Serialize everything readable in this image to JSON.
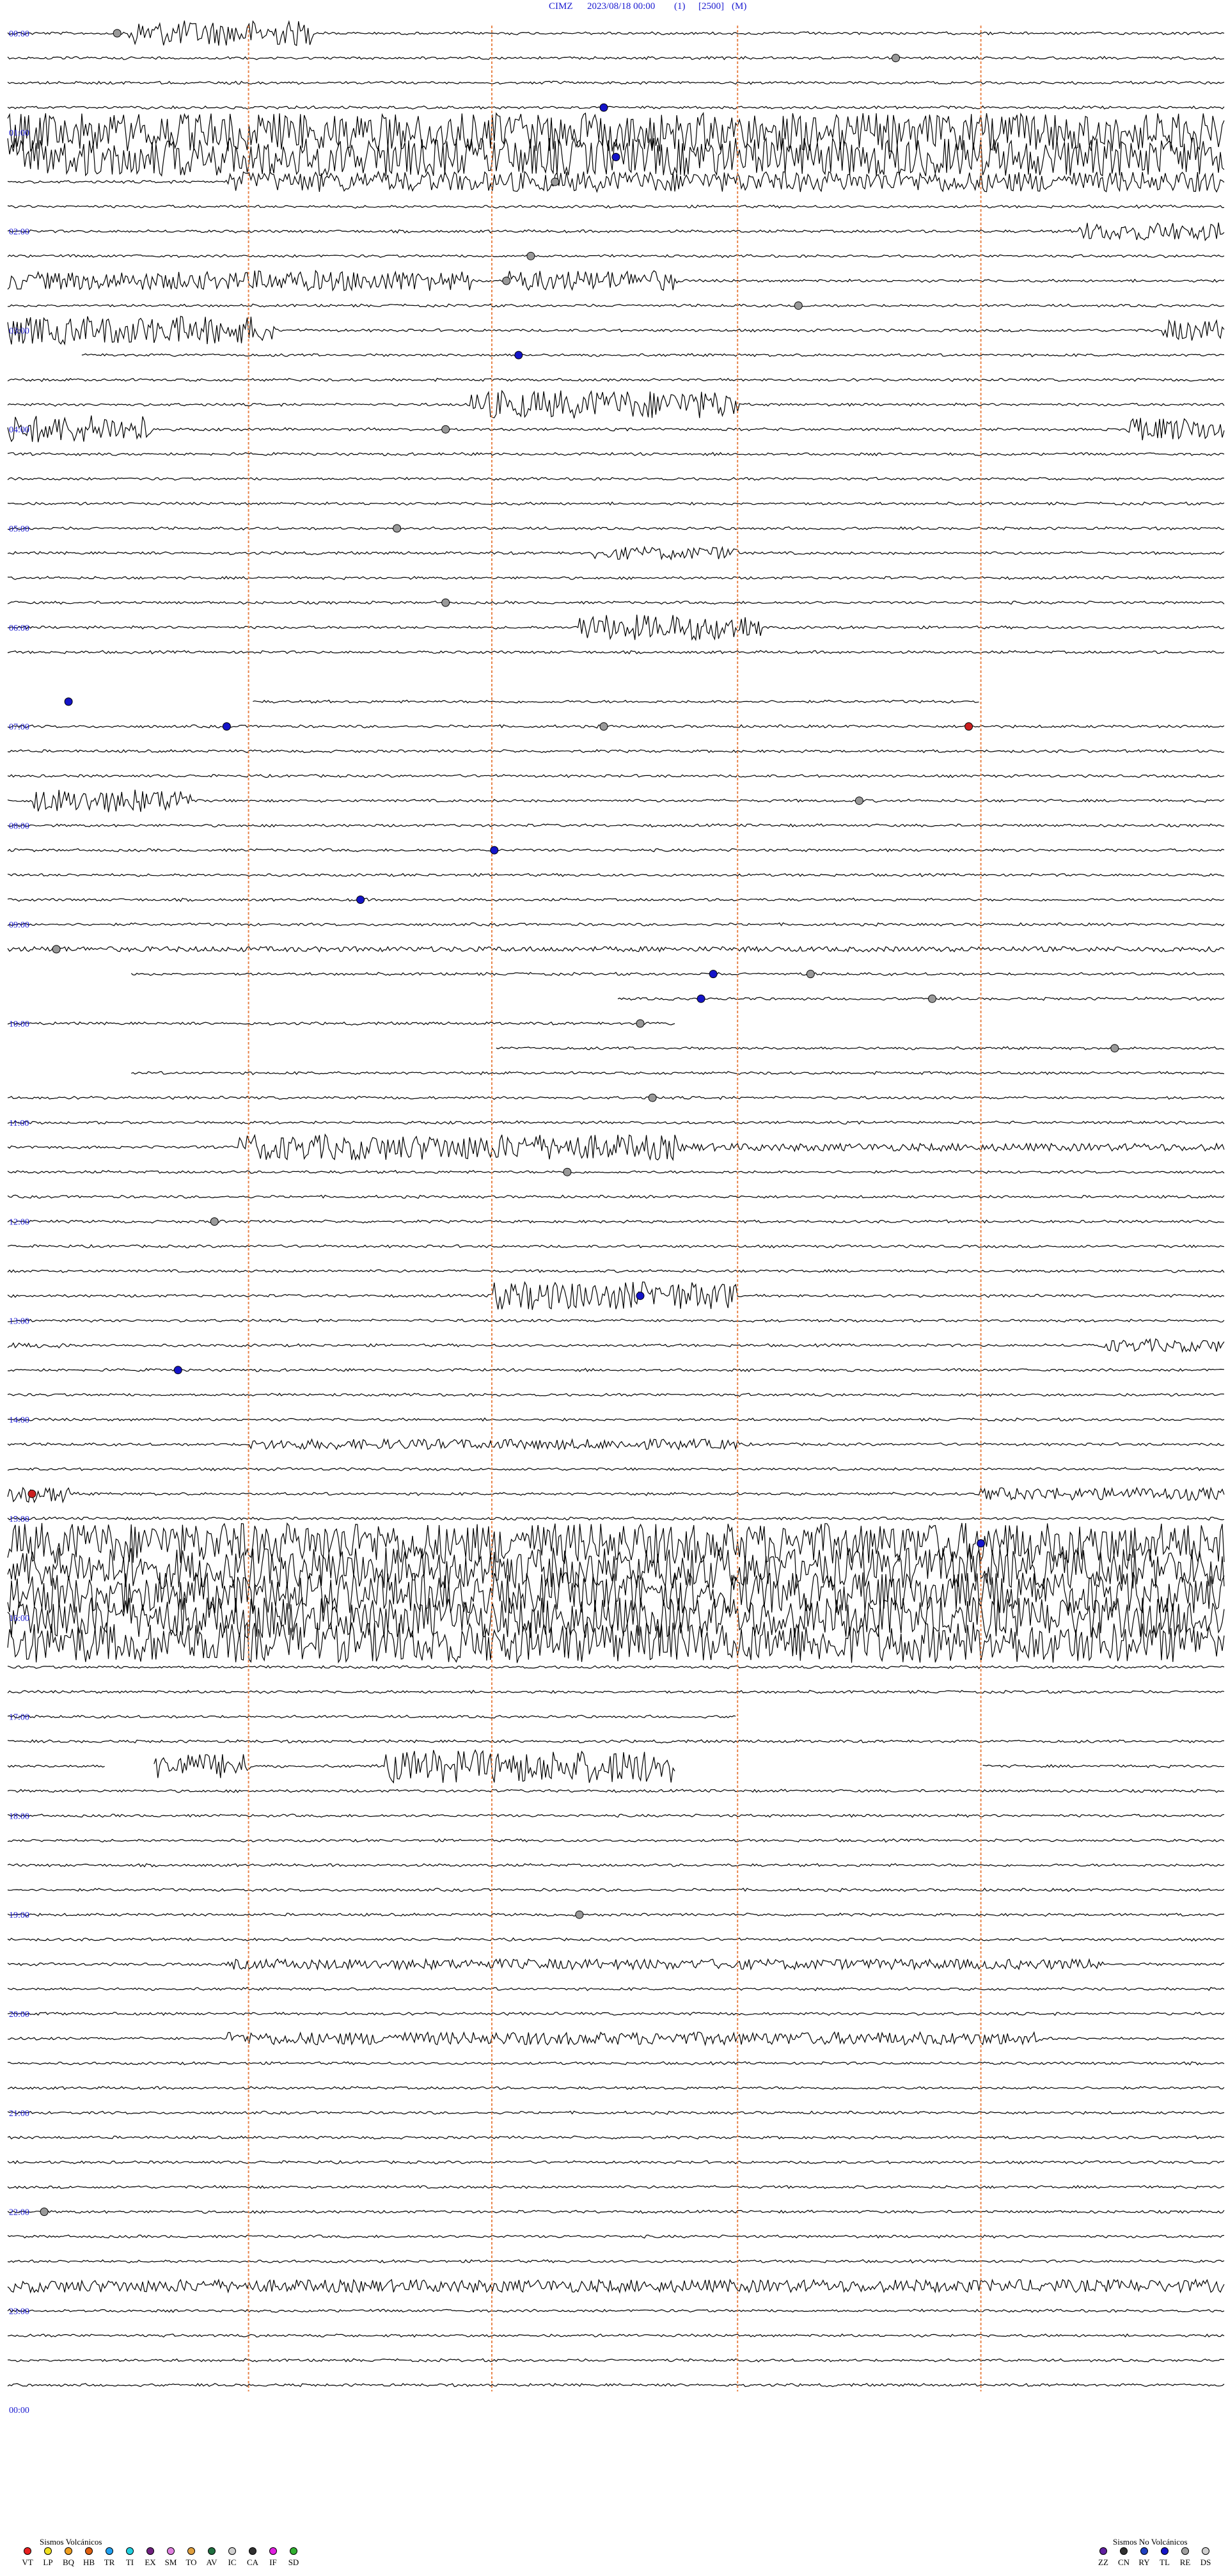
{
  "header": {
    "station": "CIMZ",
    "datetime": "2023/08/18 00:00",
    "channel": "(1)",
    "scale": "[2500]",
    "mode": "(M)"
  },
  "chart_data": {
    "type": "helicorder",
    "line_count": 96,
    "hour_labels": [
      "00:00",
      "01:00",
      "02:00",
      "03:00",
      "04:00",
      "05:00",
      "06:00",
      "07:00",
      "08:00",
      "09:00",
      "10:00",
      "11:00",
      "12:00",
      "13:00",
      "14:00",
      "15:00",
      "16:00",
      "17:00",
      "18:00",
      "19:00",
      "20:00",
      "21:00",
      "22:00",
      "23:00",
      "00:00"
    ],
    "colors": {
      "trace": "#000000",
      "hour_label": "#1a1ad0",
      "minute_marker": "#e8844a",
      "event_grey": "#9a9a9a",
      "event_blue": "#1414c8",
      "event_red": "#cc2020"
    }
  },
  "legend_volcanic": {
    "title": "Sismos Volcánicos",
    "items": [
      {
        "code": "VT",
        "color": "#e82020"
      },
      {
        "code": "LP",
        "color": "#f0e020"
      },
      {
        "code": "BQ",
        "color": "#f0a020"
      },
      {
        "code": "HB",
        "color": "#e06010"
      },
      {
        "code": "TR",
        "color": "#20a0f0"
      },
      {
        "code": "TI",
        "color": "#20d0e0"
      },
      {
        "code": "EX",
        "color": "#702080"
      },
      {
        "code": "SM",
        "color": "#e080e0"
      },
      {
        "code": "TO",
        "color": "#e0a040"
      },
      {
        "code": "AV",
        "color": "#207040"
      },
      {
        "code": "IC",
        "color": "#d0d0d0"
      },
      {
        "code": "CA",
        "color": "#303030"
      },
      {
        "code": "IF",
        "color": "#e020e0"
      },
      {
        "code": "SD",
        "color": "#30b030"
      }
    ]
  },
  "legend_non_volcanic": {
    "title": "Sismos No Volcánicos",
    "items": [
      {
        "code": "ZZ",
        "color": "#6020a0"
      },
      {
        "code": "CN",
        "color": "#303030"
      },
      {
        "code": "RY",
        "color": "#2040c0"
      },
      {
        "code": "TL",
        "color": "#1414c8"
      },
      {
        "code": "RE",
        "color": "#a0a0a0"
      },
      {
        "code": "DS",
        "color": "#d0d0d0"
      }
    ]
  }
}
